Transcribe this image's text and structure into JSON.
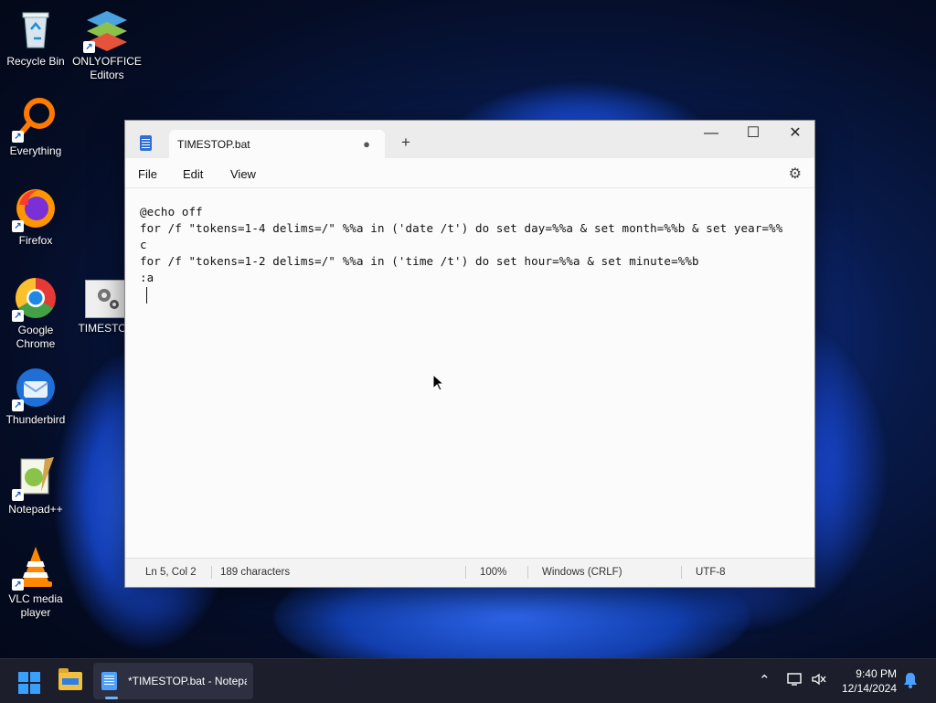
{
  "desktop": {
    "icons": [
      {
        "label": "Recycle Bin",
        "icon": "recycle-bin-icon"
      },
      {
        "label": "ONLYOFFICE Editors",
        "icon": "onlyoffice-icon"
      },
      {
        "label": "Everything",
        "icon": "everything-search-icon"
      },
      {
        "label": "Firefox",
        "icon": "firefox-icon"
      },
      {
        "label": "Google Chrome",
        "icon": "chrome-icon"
      },
      {
        "label": "TIMESTOP",
        "icon": "batch-file-icon"
      },
      {
        "label": "Thunderbird",
        "icon": "thunderbird-icon"
      },
      {
        "label": "Notepad++",
        "icon": "notepadpp-icon"
      },
      {
        "label": "VLC media player",
        "icon": "vlc-icon"
      }
    ]
  },
  "window": {
    "tab_title": "TIMESTOP.bat",
    "unsaved_indicator": "●",
    "new_tab": "+",
    "controls": {
      "minimize": "—",
      "maximize": "☐",
      "close": "✕"
    },
    "menu": {
      "file": "File",
      "edit": "Edit",
      "view": "View"
    },
    "editor_lines": [
      "@echo off",
      "for /f \"tokens=1-4 delims=/\" %%a in ('date /t') do set day=%%a & set month=%%b & set year=%%",
      "c",
      "for /f \"tokens=1-2 delims=/\" %%a in ('time /t') do set hour=%%a & set minute=%%b",
      ":a"
    ],
    "status": {
      "position": "Ln 5, Col 2",
      "characters": "189 characters",
      "zoom": "100%",
      "line_ending": "Windows (CRLF)",
      "encoding": "UTF-8"
    }
  },
  "taskbar": {
    "active_app_label": "*TIMESTOP.bat - Notepad",
    "time": "9:40 PM",
    "date": "12/14/2024"
  },
  "colors": {
    "accent": "#3aa0ff",
    "taskbar": "#1c1f2b"
  }
}
